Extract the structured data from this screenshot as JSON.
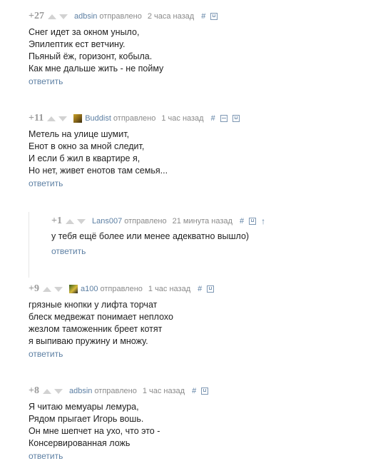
{
  "comments": [
    {
      "score": "+27",
      "user": "adbsin",
      "sent_label": "отправлено",
      "time": "2 часа назад",
      "lines": [
        "Снег идет за окном уныло,",
        "Эпилептик ест ветчину.",
        "Пьяный ёж, горизонт, кобыла.",
        "Как мне дальше жить - не пойму"
      ],
      "reply_label": "ответить"
    },
    {
      "score": "+11",
      "user": "Buddist",
      "sent_label": "отправлено",
      "time": "1 час назад",
      "lines": [
        "Метель на улице шумит,",
        "Енот в окно за мной следит,",
        "И если б жил в квартире я,",
        "Но нет, живет енотов там семья..."
      ],
      "reply_label": "ответить"
    },
    {
      "score": "+1",
      "user": "Lans007",
      "sent_label": "отправлено",
      "time": "21 минута назад",
      "lines": [
        "у тебя ещё более или менее адекватно вышло)"
      ],
      "reply_label": "ответить"
    },
    {
      "score": "+9",
      "user": "a100",
      "sent_label": "отправлено",
      "time": "1 час назад",
      "lines": [
        "грязные кнопки у лифта торчат",
        "блеск медвежат понимает неплохо",
        "жезлом таможенник бреет котят",
        "я выпиваю пружину и множу."
      ],
      "reply_label": "ответить"
    },
    {
      "score": "+8",
      "user": "adbsin",
      "sent_label": "отправлено",
      "time": "1 час назад",
      "lines": [
        "Я читаю мемуары лемура,",
        "Рядом прыгает Игорь вошь.",
        "Он мне шепчет на ухо, что это -",
        "Консервированная ложь"
      ],
      "reply_label": "ответить"
    }
  ],
  "icons": {
    "hash": "#",
    "arrow_up": "↑"
  },
  "colors": {
    "link": "#5c7fa3",
    "meta": "#8a8a8a",
    "text": "#222222",
    "vote_arrow": "#d2d2d2"
  }
}
